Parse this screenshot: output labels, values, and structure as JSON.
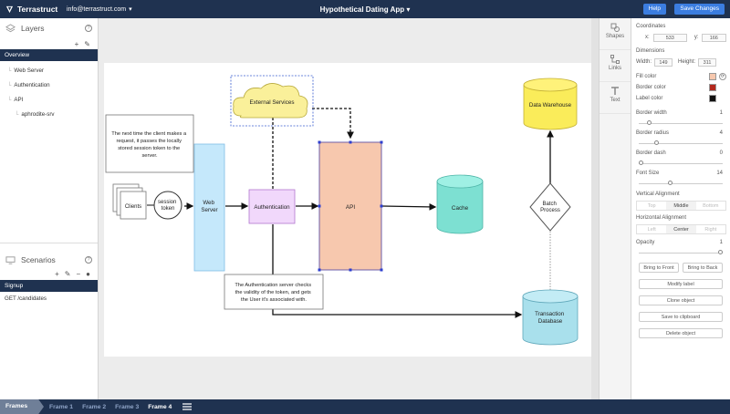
{
  "topbar": {
    "brand": "Terrastruct",
    "account": "info@terrastruct.com",
    "project": "Hypothetical Dating App",
    "help": "Help",
    "save": "Save Changes"
  },
  "layers": {
    "title": "Layers",
    "selected": "Overview",
    "items": [
      "Web Server",
      "Authentication",
      "API"
    ],
    "subitem": "aphrodite-srv"
  },
  "scenarios": {
    "title": "Scenarios",
    "selected": "Signup",
    "items": [
      "GET /candidates"
    ]
  },
  "side_tabs": [
    "Shapes",
    "Links",
    "Text"
  ],
  "properties": {
    "coordinates": "Coordinates",
    "x_label": "x:",
    "x": "533",
    "y_label": "y:",
    "y": "166",
    "dimensions": "Dimensions",
    "width_label": "Width:",
    "width": "149",
    "height_label": "Height:",
    "height": "311",
    "fill_color": "Fill color",
    "border_color": "Border color",
    "label_color": "Label color",
    "border_width": "Border width",
    "border_width_val": "1",
    "border_radius": "Border radius",
    "border_radius_val": "4",
    "border_dash": "Border dash",
    "border_dash_val": "0",
    "font_size": "Font Size",
    "font_size_val": "14",
    "vertical_alignment": "Vertical Alignment",
    "v_opts": [
      "Top",
      "Middle",
      "Bottom"
    ],
    "horizontal_alignment": "Horizontal Alignment",
    "h_opts": [
      "Left",
      "Center",
      "Right"
    ],
    "opacity": "Opacity",
    "opacity_val": "1",
    "bring_front": "Bring to Front",
    "bring_back": "Bring to Back",
    "modify_label": "Modify label",
    "clone_object": "Clone object",
    "save_clipboard": "Save to clipboard",
    "delete_object": "Delete object",
    "opacity_fraction": 1.0,
    "border_width_fraction": 0.1,
    "border_radius_fraction": 0.2,
    "border_dash_fraction": 0.0,
    "font_size_fraction": 0.35
  },
  "colors": {
    "fill": "#f7c8ae",
    "border": "#b3271c",
    "label": "#111111",
    "nav": "#1f3250",
    "accent": "#3b7de0"
  },
  "frames": {
    "label": "Frames",
    "items": [
      "Frame 1",
      "Frame 2",
      "Frame 3",
      "Frame 4"
    ],
    "active": "Frame 4"
  },
  "diagram": {
    "note1": [
      "The next time the client makes a",
      "request, it passes the locally",
      "stored session token to the",
      "server."
    ],
    "clients": "Clients",
    "session": [
      "session",
      "token"
    ],
    "web_server": [
      "Web",
      "Server"
    ],
    "external": "External Services",
    "authentication": "Authentication",
    "api": "API",
    "cache": "Cache",
    "data_warehouse": "Data Warehouse",
    "batch": [
      "Batch",
      "Process"
    ],
    "transaction": [
      "Transaction",
      "Database"
    ],
    "note2": [
      "The Authentication server checks",
      "the validity of the token, and gets",
      "the User it's associated with."
    ]
  }
}
